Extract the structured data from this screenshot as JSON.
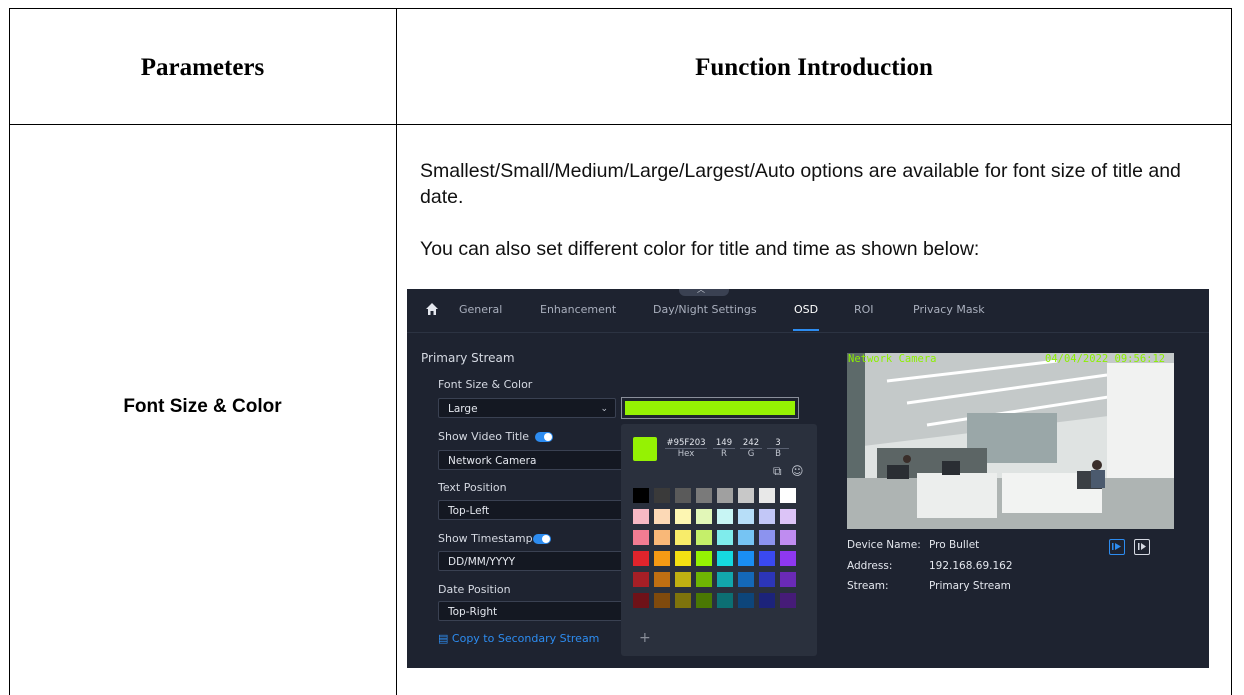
{
  "table": {
    "headers": {
      "parameters": "Parameters",
      "function": "Function Introduction"
    },
    "row": {
      "param": "Font Size & Color",
      "para1": "Smallest/Small/Medium/Large/Largest/Auto options are available for font size of title and date.",
      "para2": "You can also set different color for title and time as shown below:"
    }
  },
  "app": {
    "tabs": [
      "General",
      "Enhancement",
      "Day/Night Settings",
      "OSD",
      "ROI",
      "Privacy Mask"
    ],
    "active_tab": "OSD",
    "section_title": "Primary Stream",
    "font_size_color_label": "Font Size & Color",
    "font_size_value": "Large",
    "show_video_title_label": "Show Video Title",
    "video_title_value": "Network Camera",
    "text_position_label": "Text Position",
    "text_position_value": "Top-Left",
    "show_timestamp_label": "Show Timestamp",
    "timestamp_format_value": "DD/MM/YYYY",
    "date_position_label": "Date Position",
    "date_position_value": "Top-Right",
    "copy_link": "Copy to Secondary Stream",
    "color_picker": {
      "selected_color": "#95F203",
      "hex": "#95F203",
      "hex_label": "Hex",
      "r": "149",
      "r_label": "R",
      "g": "242",
      "g_label": "G",
      "b": "3",
      "b_label": "B",
      "add_label": "+",
      "palette": [
        [
          "#000000",
          "#3a3a3a",
          "#5a5a5a",
          "#7a7a7a",
          "#a0a0a0",
          "#c8c8c8",
          "#e8e8e8",
          "#ffffff"
        ],
        [
          "#f7b9c4",
          "#fcd9b6",
          "#fdf6b2",
          "#e2f7b8",
          "#c8f5f4",
          "#b7def8",
          "#c2c7f7",
          "#dcc4f7"
        ],
        [
          "#f27c92",
          "#f9b878",
          "#f8ec6a",
          "#c5ef6a",
          "#7fecec",
          "#76c4f3",
          "#8c93ef",
          "#bf8cf0"
        ],
        [
          "#e0242c",
          "#f59a14",
          "#f4e013",
          "#95F203",
          "#16d9e0",
          "#1a8ef3",
          "#3a49f0",
          "#8e38f0"
        ],
        [
          "#a61f26",
          "#c06f12",
          "#c0b012",
          "#6fb503",
          "#12a7ad",
          "#1468b8",
          "#2c35b8",
          "#6a2ab6"
        ],
        [
          "#6e1218",
          "#7f4a0d",
          "#7e730c",
          "#4a7803",
          "#0c6f73",
          "#0d457a",
          "#1c237a",
          "#461c78"
        ]
      ]
    },
    "osd_title": "Network Camera",
    "osd_timestamp": "04/04/2022 09:56:12",
    "device_name_label": "Device Name:",
    "device_name_value": "Pro Bullet",
    "address_label": "Address:",
    "address_value": "192.168.69.162",
    "stream_label": "Stream:",
    "stream_value": "Primary Stream"
  }
}
